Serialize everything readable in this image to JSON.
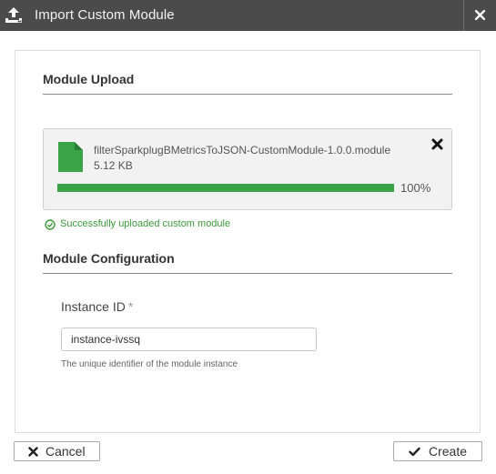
{
  "dialog": {
    "title": "Import Custom Module",
    "icons": {
      "header": "upload-icon",
      "close": "close-icon"
    }
  },
  "upload_section": {
    "title": "Module Upload",
    "file": {
      "name": "filterSparkplugBMetricsToJSON-CustomModule-1.0.0.module",
      "size": "5.12 KB",
      "progress_label": "100%",
      "progress_fraction": 1.0,
      "icon": "file-icon"
    },
    "status_message": "Successfully uploaded custom module",
    "status_icon": "check-circle-icon"
  },
  "config_section": {
    "title": "Module Configuration",
    "instance_id": {
      "label": "Instance ID",
      "required_mark": "*",
      "value": "instance-ivssq",
      "help": "The unique identifier of the module instance"
    }
  },
  "footer": {
    "cancel_label": "Cancel",
    "create_label": "Create"
  },
  "colors": {
    "titlebar": "#4b4b4b",
    "progress": "#3aa348",
    "success": "#3a9a3a"
  }
}
